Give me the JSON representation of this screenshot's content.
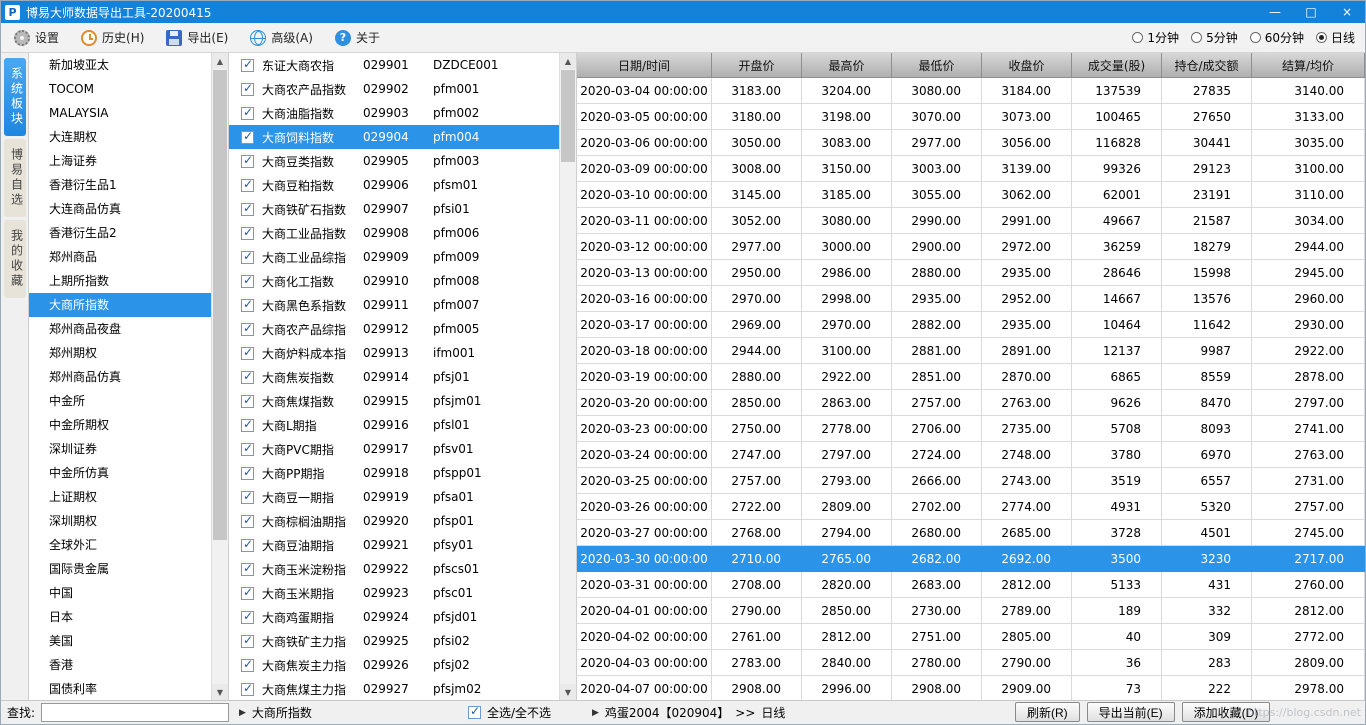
{
  "colors": {
    "titlebar": "#1482d8",
    "highlight": "#2b93e8",
    "tab_selected": "#1f87e0"
  },
  "titlebar": {
    "icon_letter": "P",
    "title": "博易大师数据导出工具-20200415",
    "controls": {
      "minimize": "—",
      "maximize": "□",
      "close": "×"
    }
  },
  "toolbar": {
    "items": [
      {
        "id": "settings",
        "icon": "gear-icon",
        "label": "设置"
      },
      {
        "id": "history",
        "icon": "history-icon",
        "label": "历史(H)"
      },
      {
        "id": "export",
        "icon": "save-icon",
        "label": "导出(E)"
      },
      {
        "id": "advanced",
        "icon": "globe-icon",
        "label": "高级(A)"
      },
      {
        "id": "about",
        "icon": "help-icon",
        "label": "关于"
      }
    ],
    "periods": [
      {
        "label": "1分钟",
        "selected": false
      },
      {
        "label": "5分钟",
        "selected": false
      },
      {
        "label": "60分钟",
        "selected": false
      },
      {
        "label": "日线",
        "selected": true
      }
    ]
  },
  "side_tabs": [
    {
      "id": "system",
      "label": "系统板块",
      "selected": true
    },
    {
      "id": "custom",
      "label": "博易自选",
      "selected": false
    },
    {
      "id": "favorite",
      "label": "我的收藏",
      "selected": false
    }
  ],
  "sidebar": {
    "items": [
      "新加坡亚太",
      "TOCOM",
      "MALAYSIA",
      "大连期权",
      "上海证券",
      "香港衍生品1",
      "大连商品仿真",
      "香港衍生品2",
      "郑州商品",
      "上期所指数",
      "大商所指数",
      "郑州商品夜盘",
      "郑州期权",
      "郑州商品仿真",
      "中金所",
      "中金所期权",
      "深圳证券",
      "中金所仿真",
      "上证期权",
      "深圳期权",
      "全球外汇",
      "国际贵金属",
      "中国",
      "日本",
      "美国",
      "香港",
      "国债利率"
    ],
    "selected_index": 10
  },
  "contracts": {
    "selected_index": 3,
    "items": [
      {
        "name": "东证大商农指",
        "code": "029901",
        "symbol": "DZDCE001"
      },
      {
        "name": "大商农产品指数",
        "code": "029902",
        "symbol": "pfm001"
      },
      {
        "name": "大商油脂指数",
        "code": "029903",
        "symbol": "pfm002"
      },
      {
        "name": "大商饲料指数",
        "code": "029904",
        "symbol": "pfm004"
      },
      {
        "name": "大商豆类指数",
        "code": "029905",
        "symbol": "pfm003"
      },
      {
        "name": "大商豆粕指数",
        "code": "029906",
        "symbol": "pfsm01"
      },
      {
        "name": "大商铁矿石指数",
        "code": "029907",
        "symbol": "pfsi01"
      },
      {
        "name": "大商工业品指数",
        "code": "029908",
        "symbol": "pfm006"
      },
      {
        "name": "大商工业品综指",
        "code": "029909",
        "symbol": "pfm009"
      },
      {
        "name": "大商化工指数",
        "code": "029910",
        "symbol": "pfm008"
      },
      {
        "name": "大商黑色系指数",
        "code": "029911",
        "symbol": "pfm007"
      },
      {
        "name": "大商农产品综指",
        "code": "029912",
        "symbol": "pfm005"
      },
      {
        "name": "大商炉料成本指",
        "code": "029913",
        "symbol": "ifm001"
      },
      {
        "name": "大商焦炭指数",
        "code": "029914",
        "symbol": "pfsj01"
      },
      {
        "name": "大商焦煤指数",
        "code": "029915",
        "symbol": "pfsjm01"
      },
      {
        "name": "大商L期指",
        "code": "029916",
        "symbol": "pfsl01"
      },
      {
        "name": "大商PVC期指",
        "code": "029917",
        "symbol": "pfsv01"
      },
      {
        "name": "大商PP期指",
        "code": "029918",
        "symbol": "pfspp01"
      },
      {
        "name": "大商豆一期指",
        "code": "029919",
        "symbol": "pfsa01"
      },
      {
        "name": "大商棕榈油期指",
        "code": "029920",
        "symbol": "pfsp01"
      },
      {
        "name": "大商豆油期指",
        "code": "029921",
        "symbol": "pfsy01"
      },
      {
        "name": "大商玉米淀粉指",
        "code": "029922",
        "symbol": "pfscs01"
      },
      {
        "name": "大商玉米期指",
        "code": "029923",
        "symbol": "pfsc01"
      },
      {
        "name": "大商鸡蛋期指",
        "code": "029924",
        "symbol": "pfsjd01"
      },
      {
        "name": "大商铁矿主力指",
        "code": "029925",
        "symbol": "pfsi02"
      },
      {
        "name": "大商焦炭主力指",
        "code": "029926",
        "symbol": "pfsj02"
      },
      {
        "name": "大商焦煤主力指",
        "code": "029927",
        "symbol": "pfsjm02"
      }
    ]
  },
  "table": {
    "headers": [
      "日期/时间",
      "开盘价",
      "最高价",
      "最低价",
      "收盘价",
      "成交量(股)",
      "持仓/成交额",
      "结算/均价"
    ],
    "selected_index": 18,
    "rows": [
      [
        "2020-03-04 00:00:00",
        "3183.00",
        "3204.00",
        "3080.00",
        "3184.00",
        "137539",
        "27835",
        "3140.00"
      ],
      [
        "2020-03-05 00:00:00",
        "3180.00",
        "3198.00",
        "3070.00",
        "3073.00",
        "100465",
        "27650",
        "3133.00"
      ],
      [
        "2020-03-06 00:00:00",
        "3050.00",
        "3083.00",
        "2977.00",
        "3056.00",
        "116828",
        "30441",
        "3035.00"
      ],
      [
        "2020-03-09 00:00:00",
        "3008.00",
        "3150.00",
        "3003.00",
        "3139.00",
        "99326",
        "29123",
        "3100.00"
      ],
      [
        "2020-03-10 00:00:00",
        "3145.00",
        "3185.00",
        "3055.00",
        "3062.00",
        "62001",
        "23191",
        "3110.00"
      ],
      [
        "2020-03-11 00:00:00",
        "3052.00",
        "3080.00",
        "2990.00",
        "2991.00",
        "49667",
        "21587",
        "3034.00"
      ],
      [
        "2020-03-12 00:00:00",
        "2977.00",
        "3000.00",
        "2900.00",
        "2972.00",
        "36259",
        "18279",
        "2944.00"
      ],
      [
        "2020-03-13 00:00:00",
        "2950.00",
        "2986.00",
        "2880.00",
        "2935.00",
        "28646",
        "15998",
        "2945.00"
      ],
      [
        "2020-03-16 00:00:00",
        "2970.00",
        "2998.00",
        "2935.00",
        "2952.00",
        "14667",
        "13576",
        "2960.00"
      ],
      [
        "2020-03-17 00:00:00",
        "2969.00",
        "2970.00",
        "2882.00",
        "2935.00",
        "10464",
        "11642",
        "2930.00"
      ],
      [
        "2020-03-18 00:00:00",
        "2944.00",
        "3100.00",
        "2881.00",
        "2891.00",
        "12137",
        "9987",
        "2922.00"
      ],
      [
        "2020-03-19 00:00:00",
        "2880.00",
        "2922.00",
        "2851.00",
        "2870.00",
        "6865",
        "8559",
        "2878.00"
      ],
      [
        "2020-03-20 00:00:00",
        "2850.00",
        "2863.00",
        "2757.00",
        "2763.00",
        "9626",
        "8470",
        "2797.00"
      ],
      [
        "2020-03-23 00:00:00",
        "2750.00",
        "2778.00",
        "2706.00",
        "2735.00",
        "5708",
        "8093",
        "2741.00"
      ],
      [
        "2020-03-24 00:00:00",
        "2747.00",
        "2797.00",
        "2724.00",
        "2748.00",
        "3780",
        "6970",
        "2763.00"
      ],
      [
        "2020-03-25 00:00:00",
        "2757.00",
        "2793.00",
        "2666.00",
        "2743.00",
        "3519",
        "6557",
        "2731.00"
      ],
      [
        "2020-03-26 00:00:00",
        "2722.00",
        "2809.00",
        "2702.00",
        "2774.00",
        "4931",
        "5320",
        "2757.00"
      ],
      [
        "2020-03-27 00:00:00",
        "2768.00",
        "2794.00",
        "2680.00",
        "2685.00",
        "3728",
        "4501",
        "2745.00"
      ],
      [
        "2020-03-30 00:00:00",
        "2710.00",
        "2765.00",
        "2682.00",
        "2692.00",
        "3500",
        "3230",
        "2717.00"
      ],
      [
        "2020-03-31 00:00:00",
        "2708.00",
        "2820.00",
        "2683.00",
        "2812.00",
        "5133",
        "431",
        "2760.00"
      ],
      [
        "2020-04-01 00:00:00",
        "2790.00",
        "2850.00",
        "2730.00",
        "2789.00",
        "189",
        "332",
        "2812.00"
      ],
      [
        "2020-04-02 00:00:00",
        "2761.00",
        "2812.00",
        "2751.00",
        "2805.00",
        "40",
        "309",
        "2772.00"
      ],
      [
        "2020-04-03 00:00:00",
        "2783.00",
        "2840.00",
        "2780.00",
        "2790.00",
        "36",
        "283",
        "2809.00"
      ],
      [
        "2020-04-07 00:00:00",
        "2908.00",
        "2996.00",
        "2908.00",
        "2909.00",
        "73",
        "222",
        "2978.00"
      ]
    ]
  },
  "bottombar": {
    "find_label": "查找:",
    "find_value": "",
    "group_label": "大商所指数",
    "select_all_label": "全选/全不选",
    "current_contract": "鸡蛋2004【020904】",
    "current_separator": ">>",
    "current_period": "日线",
    "buttons": [
      "刷新(R)",
      "导出当前(E)",
      "添加收藏(D)"
    ]
  },
  "watermark": {
    "text": "https://blog.csdn.net"
  }
}
